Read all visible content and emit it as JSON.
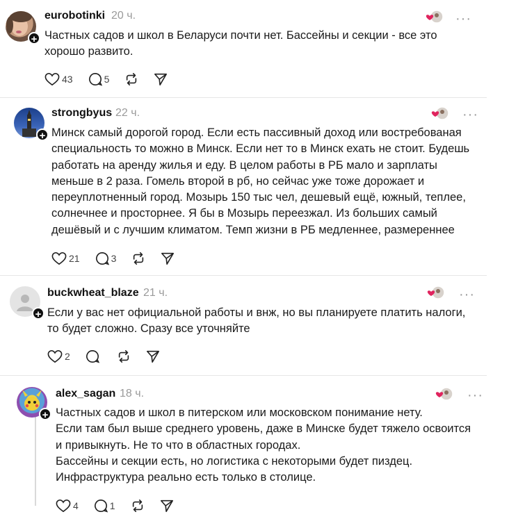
{
  "posts": [
    {
      "username": "eurobotinki",
      "time": "20 ч.",
      "text": "Частных садов и школ в Беларуси почти нет. Бассейны и секции - все это\nхорошо развито.",
      "likes": "43",
      "replies": "5",
      "repost": "",
      "share": ""
    },
    {
      "username": "strongbyus",
      "time": "22 ч.",
      "text": "Минск самый дорогой город. Если есть пассивный доход или востребованая\nспециальность то можно в Минск. Если нет то в Минск ехать не стоит. Будешь\nработать на аренду жилья и еду. В целом работы в РБ мало и зарплаты\nменьше в 2 раза. Гомель второй в рб, но сейчас уже тоже дорожает и\nпереуплотненный город. Мозырь 150 тыс чел, дешевый ещё, южный, теплее,\nсолнечнее и просторнее. Я бы в Мозырь переезжал. Из больших самый\nдешёвый и с лучшим климатом. Темп жизни в РБ медленнее, размереннее",
      "likes": "21",
      "replies": "3"
    },
    {
      "username": "buckwheat_blaze",
      "time": "21 ч.",
      "text": "Если у вас нет официальной работы и внж, но вы планируете платить налоги,\nто будет сложно. Сразу все уточняйте",
      "likes": "2",
      "replies": ""
    },
    {
      "username": "alex_sagan",
      "time": "18 ч.",
      "text": "Частных садов и школ в питерском или московском понимание нету.\nЕсли там был выше среднего уровень, даже в Минске будет тяжело освоится\nи привыкнуть. Не то что в областных городах.\nБассейны и секции есть, но логистика с некоторыми будет пиздец.\nИнфраструктура реально есть только в столице.",
      "likes": "4",
      "replies": "1"
    }
  ],
  "colors": {
    "heart": "#e0245e",
    "muted": "#9a9a9a"
  }
}
